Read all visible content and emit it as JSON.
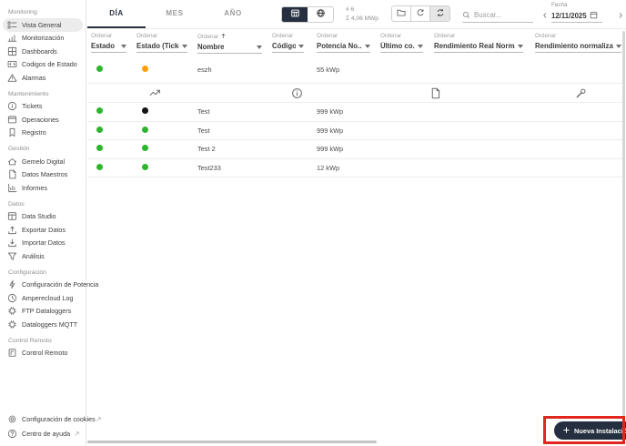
{
  "colors": {
    "navy": "#252f3f",
    "green": "#2db52d",
    "orange": "#ffa000",
    "black": "#141414",
    "annotation_red": "#e0261d"
  },
  "sidebar": {
    "sections": [
      {
        "title": "Monitoring",
        "items": [
          {
            "label": "Vista General",
            "icon": "view-list-icon",
            "selected": true
          },
          {
            "label": "Monitorización",
            "icon": "bar-chart-icon"
          },
          {
            "label": "Dashboards",
            "icon": "dashboard-icon"
          },
          {
            "label": "Codigos de Estado",
            "icon": "code-tag-icon"
          },
          {
            "label": "Alarmas",
            "icon": "warning-triangle-icon"
          }
        ]
      },
      {
        "title": "Mantenimiento",
        "items": [
          {
            "label": "Tickets",
            "icon": "info-circle-icon"
          },
          {
            "label": "Operaciones",
            "icon": "calendar-grid-icon"
          },
          {
            "label": "Registro",
            "icon": "bookmark-icon"
          }
        ]
      },
      {
        "title": "Gestión",
        "items": [
          {
            "label": "Gemelo Digital",
            "icon": "digital-twin-icon"
          },
          {
            "label": "Datos Maestros",
            "icon": "document-icon"
          },
          {
            "label": "Informes",
            "icon": "report-chart-icon"
          }
        ]
      },
      {
        "title": "Datos",
        "items": [
          {
            "label": "Data Studio",
            "icon": "table-icon"
          },
          {
            "label": "Exportar Datos",
            "icon": "export-icon"
          },
          {
            "label": "Importar Datos",
            "icon": "import-icon"
          },
          {
            "label": "Análisis",
            "icon": "funnel-icon"
          }
        ]
      },
      {
        "title": "Configuración",
        "items": [
          {
            "label": "Configuración de Potencia",
            "icon": "power-icon"
          },
          {
            "label": "Amperecloud Log",
            "icon": "history-clock-icon"
          },
          {
            "label": "FTP Dataloggers",
            "icon": "chip-icon"
          },
          {
            "label": "Dataloggers MQTT",
            "icon": "chip-icon"
          }
        ]
      },
      {
        "title": "Control Remoto",
        "items": [
          {
            "label": "Control Remoto",
            "icon": "remote-control-icon"
          }
        ]
      }
    ],
    "footer": [
      {
        "label": "Configuración de cookies",
        "icon": "gear-icon"
      },
      {
        "label": "Centro de ayuda",
        "icon": "help-circle-icon"
      }
    ]
  },
  "toolbar": {
    "tabs": [
      {
        "label": "DÍA",
        "active": true
      },
      {
        "label": "MES",
        "active": false
      },
      {
        "label": "AÑO",
        "active": false
      }
    ],
    "count_label": "# 6",
    "sum_label": "Σ 4,06 MWp",
    "search_placeholder": "Buscar...",
    "date_label": "Fecha",
    "date_value": "12/11/2025"
  },
  "table": {
    "sort_label": "Ordenar",
    "columns": [
      {
        "label": "Estado"
      },
      {
        "label": "Estado (Ticke..."
      },
      {
        "label": "Nombre",
        "sorted": "asc"
      },
      {
        "label": "Código..."
      },
      {
        "label": "Potencia No..."
      },
      {
        "label": "Último co..."
      },
      {
        "label": "Rendimiento Real Normaliz..."
      },
      {
        "label": "Rendimiento normalizado ..."
      }
    ],
    "rows": [
      {
        "estado": "green",
        "ticket": "orange",
        "nombre": "eszh",
        "potencia": "55 kWp"
      },
      {
        "expanded": true,
        "icons": [
          "trend-icon",
          "info-circle-icon",
          "document-icon",
          "wrench-icon"
        ]
      },
      {
        "estado": "green",
        "ticket": "black",
        "nombre": "Test",
        "potencia": "999 kWp"
      },
      {
        "estado": "green",
        "ticket": "green",
        "nombre": "Test",
        "potencia": "999 kWp"
      },
      {
        "estado": "green",
        "ticket": "green",
        "nombre": "Test 2",
        "potencia": "999 kWp"
      },
      {
        "estado": "green",
        "ticket": "green",
        "nombre": "Test233",
        "potencia": "12 kWp"
      }
    ]
  },
  "fab": {
    "label": "Nueva Instalación"
  }
}
